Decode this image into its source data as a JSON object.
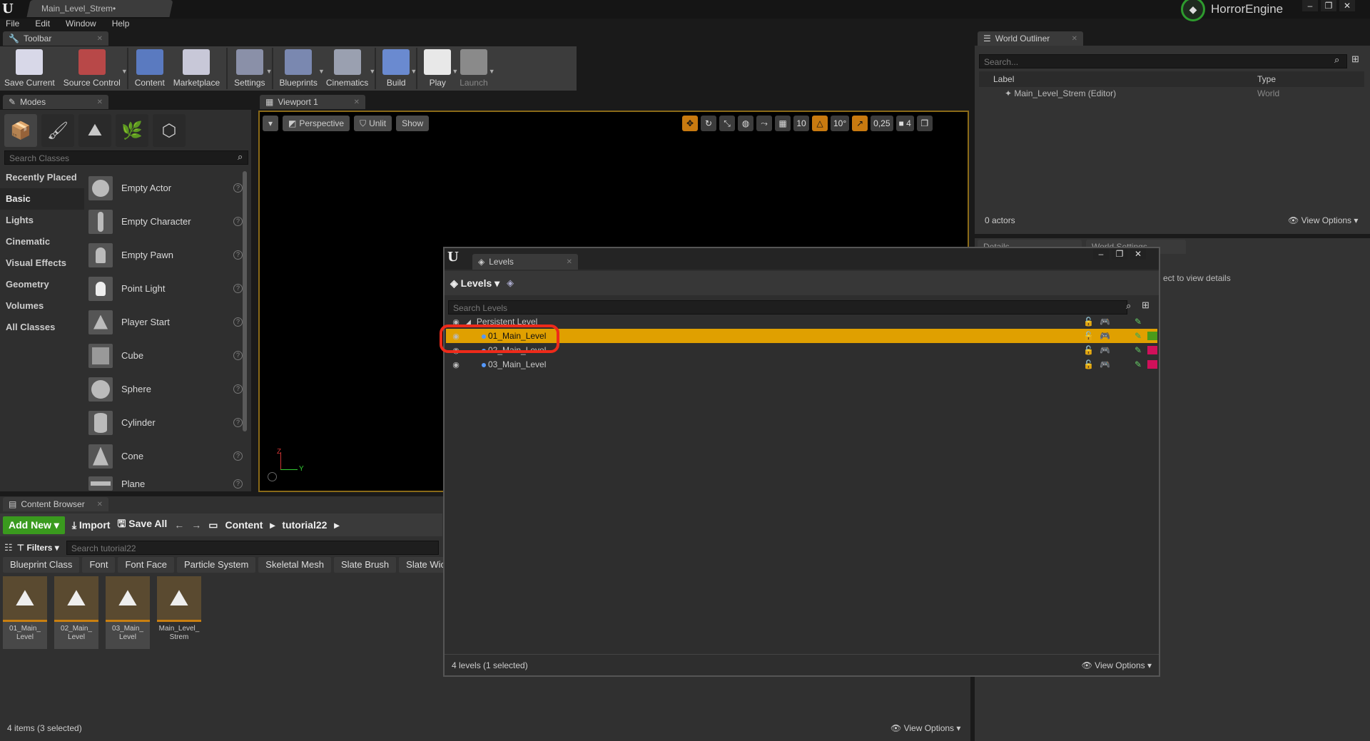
{
  "app": {
    "doc_tab": "Main_Level_Strem•",
    "brand": "HorrorEngine",
    "window_buttons": [
      "–",
      "❐",
      "✕"
    ]
  },
  "menu": [
    "File",
    "Edit",
    "Window",
    "Help"
  ],
  "toolbar": {
    "tab": "Toolbar",
    "items": [
      {
        "label": "Save Current",
        "color": "#d8d8e8"
      },
      {
        "label": "Source Control",
        "color": "#b84848"
      },
      {
        "label": "Content",
        "color": "#5a7ac0"
      },
      {
        "label": "Marketplace",
        "color": "#c8c8d8"
      },
      {
        "label": "Settings",
        "color": "#8a90a8"
      },
      {
        "label": "Blueprints",
        "color": "#7a88b0"
      },
      {
        "label": "Cinematics",
        "color": "#9aa0b0"
      },
      {
        "label": "Build",
        "color": "#6a8ad0"
      },
      {
        "label": "Play",
        "color": "#e8e8e8"
      },
      {
        "label": "Launch",
        "color": "#8a8a8a"
      }
    ]
  },
  "modes": {
    "tab": "Modes",
    "search_placeholder": "Search Classes",
    "categories": [
      "Recently Placed",
      "Basic",
      "Lights",
      "Cinematic",
      "Visual Effects",
      "Geometry",
      "Volumes",
      "All Classes"
    ],
    "selected_category": "Basic",
    "objects": [
      "Empty Actor",
      "Empty Character",
      "Empty Pawn",
      "Point Light",
      "Player Start",
      "Cube",
      "Sphere",
      "Cylinder",
      "Cone",
      "Plane"
    ]
  },
  "viewport": {
    "tab": "Viewport 1",
    "perspective": "Perspective",
    "lit": "Unlit",
    "show": "Show",
    "grid": "10",
    "rot": "10°",
    "scale": "0,25",
    "cam": "4",
    "axis_y": "Y",
    "axis_z": "Z"
  },
  "outliner": {
    "tab": "World Outliner",
    "search_placeholder": "Search...",
    "col_label": "Label",
    "col_type": "Type",
    "rows": [
      {
        "label": "Main_Level_Strem (Editor)",
        "type": "World"
      }
    ],
    "count": "0 actors",
    "view_options": "View Options"
  },
  "details": {
    "tab1": "Details",
    "tab2": "World Settings",
    "hint": "ect to view details"
  },
  "content_browser": {
    "tab": "Content Browser",
    "add_new": "Add New",
    "import": "Import",
    "save_all": "Save All",
    "path": [
      "Content",
      "tutorial22"
    ],
    "filters": "Filters",
    "search_placeholder": "Search tutorial22",
    "chips": [
      "Blueprint Class",
      "Font",
      "Font Face",
      "Particle System",
      "Skeletal Mesh",
      "Slate Brush",
      "Slate Wic"
    ],
    "assets": [
      {
        "name": "01_Main_ Level",
        "selected": true
      },
      {
        "name": "02_Main_ Level",
        "selected": true
      },
      {
        "name": "03_Main_ Level",
        "selected": true
      },
      {
        "name": "Main_Level_ Strem",
        "selected": false
      }
    ],
    "status": "4 items (3 selected)",
    "view_options": "View Options"
  },
  "levels": {
    "tab": "Levels",
    "menu": "Levels",
    "search_placeholder": "Search Levels",
    "rows": [
      {
        "name": "Persistent Level",
        "selected": false,
        "color": ""
      },
      {
        "name": "01_Main_Level",
        "selected": true,
        "color": "#4a9a1a"
      },
      {
        "name": "02_Main_Level",
        "selected": false,
        "color": "#d0105a"
      },
      {
        "name": "03_Main_Level",
        "selected": false,
        "color": "#d0105a"
      }
    ],
    "status": "4 levels (1 selected)",
    "view_options": "View Options"
  }
}
